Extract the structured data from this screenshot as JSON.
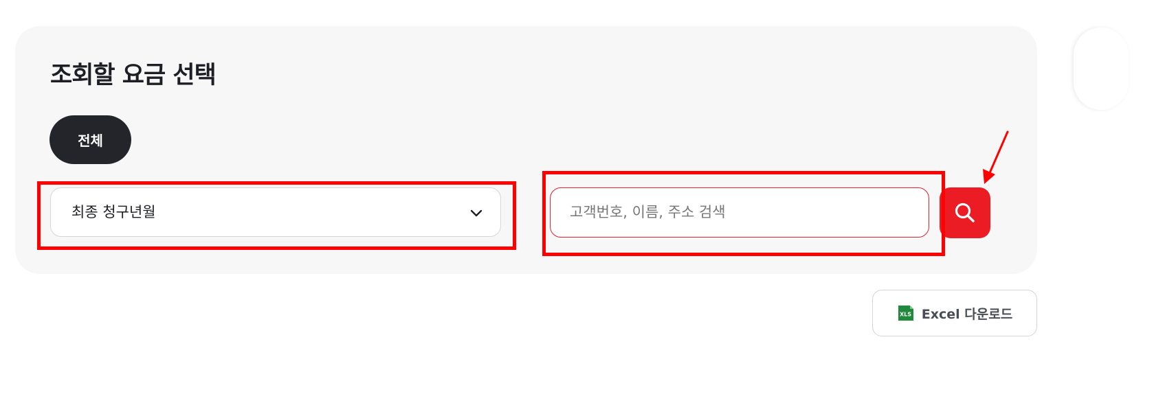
{
  "filter_panel": {
    "title": "조회할 요금 선택",
    "chip_label": "전체",
    "period_select": {
      "selected": "최종 청구년월",
      "icon": "chevron-down-icon"
    },
    "search": {
      "placeholder": "고객번호, 이름, 주소 검색",
      "value": "",
      "button_icon": "search-icon"
    }
  },
  "actions": {
    "excel_download_label": "Excel 다운로드",
    "excel_icon_text": "XLS"
  },
  "colors": {
    "accent": "#ec1c24",
    "chip_bg": "#23252b",
    "panel_bg": "#f7f7f7",
    "annotation": "#ff0000",
    "excel_green": "#1f8a3b"
  }
}
